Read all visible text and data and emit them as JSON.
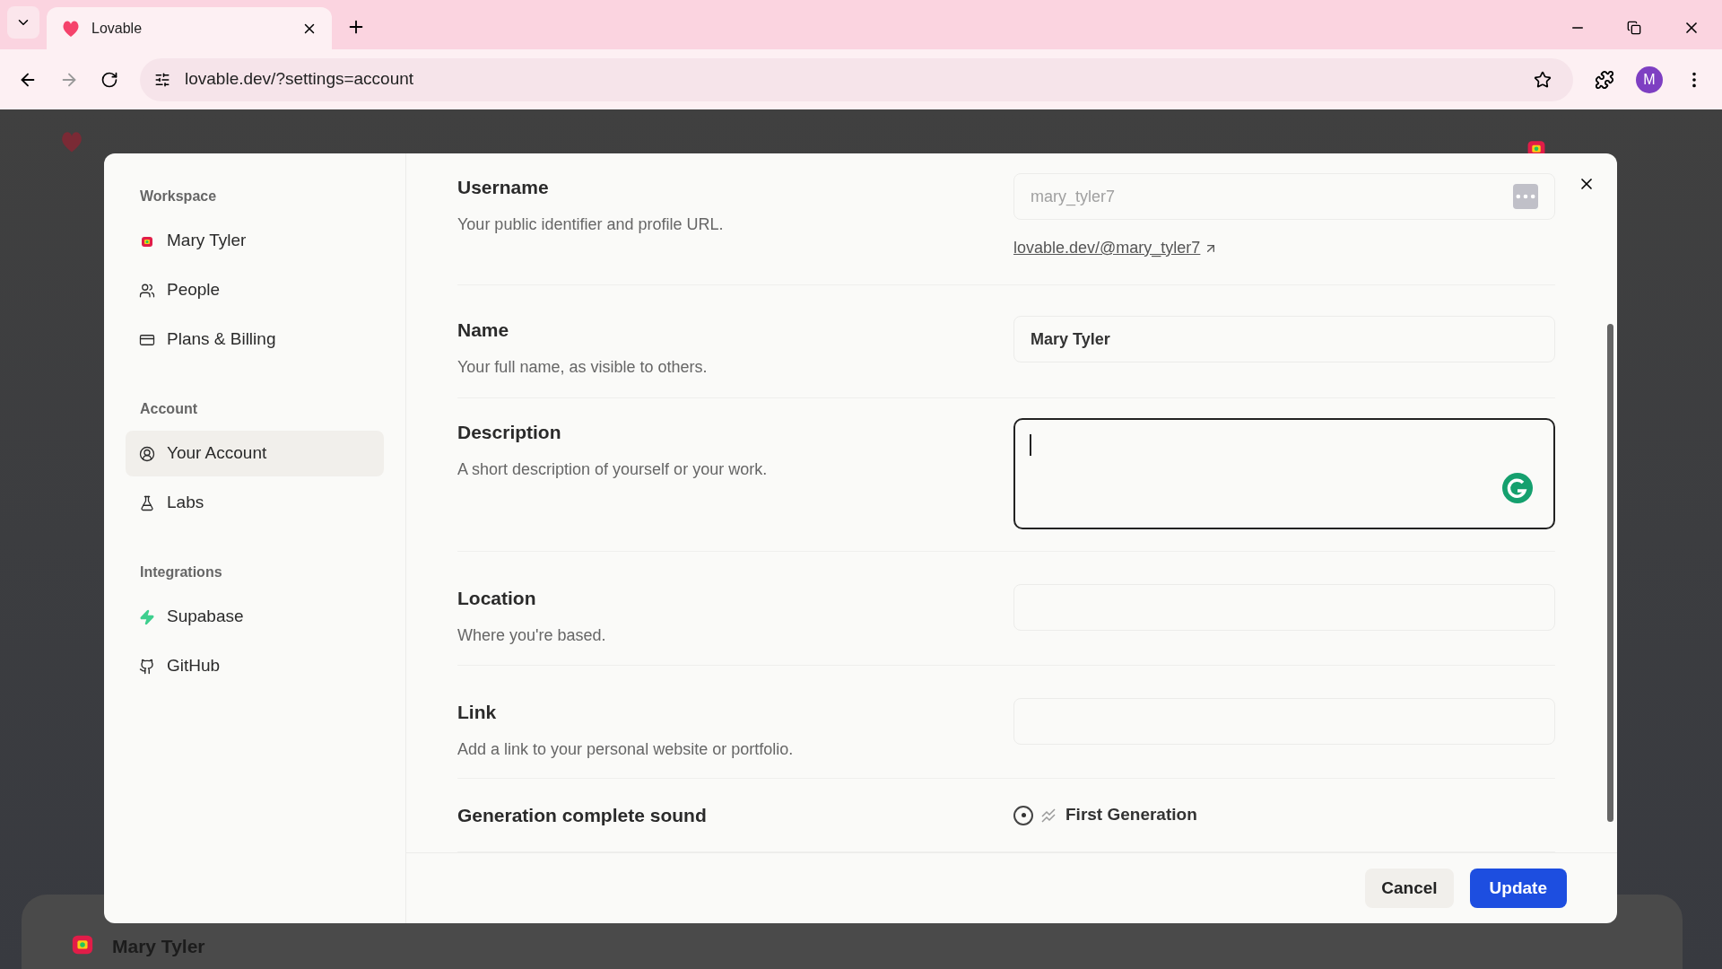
{
  "browser": {
    "tab_title": "Lovable",
    "address": "lovable.dev/?settings=account",
    "profile_initial": "M"
  },
  "background": {
    "card_name": "Mary Tyler"
  },
  "sidebar": {
    "sections": [
      {
        "heading": "Workspace",
        "items": [
          {
            "label": "Mary Tyler",
            "selected": false
          },
          {
            "label": "People",
            "selected": false
          },
          {
            "label": "Plans & Billing",
            "selected": false
          }
        ]
      },
      {
        "heading": "Account",
        "items": [
          {
            "label": "Your Account",
            "selected": true
          },
          {
            "label": "Labs",
            "selected": false
          }
        ]
      },
      {
        "heading": "Integrations",
        "items": [
          {
            "label": "Supabase",
            "selected": false
          },
          {
            "label": "GitHub",
            "selected": false
          }
        ]
      }
    ]
  },
  "fields": [
    {
      "kind": "text",
      "label": "Username",
      "description": "Your public identifier and profile URL.",
      "value": "mary_tyler7",
      "disabled": true,
      "focused": false,
      "link": "lovable.dev/@mary_tyler7"
    },
    {
      "kind": "text",
      "label": "Name",
      "description": "Your full name, as visible to others.",
      "value": "Mary Tyler",
      "disabled": false,
      "focused": false
    },
    {
      "kind": "textarea",
      "label": "Description",
      "description": "A short description of yourself or your work.",
      "disabled": false,
      "focused": true
    },
    {
      "kind": "text",
      "label": "Location",
      "description": "Where you're based.",
      "disabled": false,
      "focused": false
    },
    {
      "kind": "text",
      "label": "Link",
      "description": "Add a link to your personal website or portfolio.",
      "disabled": false,
      "focused": false
    },
    {
      "kind": "radio",
      "label": "Generation complete sound",
      "option": "First Generation",
      "selected": true
    }
  ],
  "buttons": {
    "cancel": "Cancel",
    "update": "Update"
  }
}
